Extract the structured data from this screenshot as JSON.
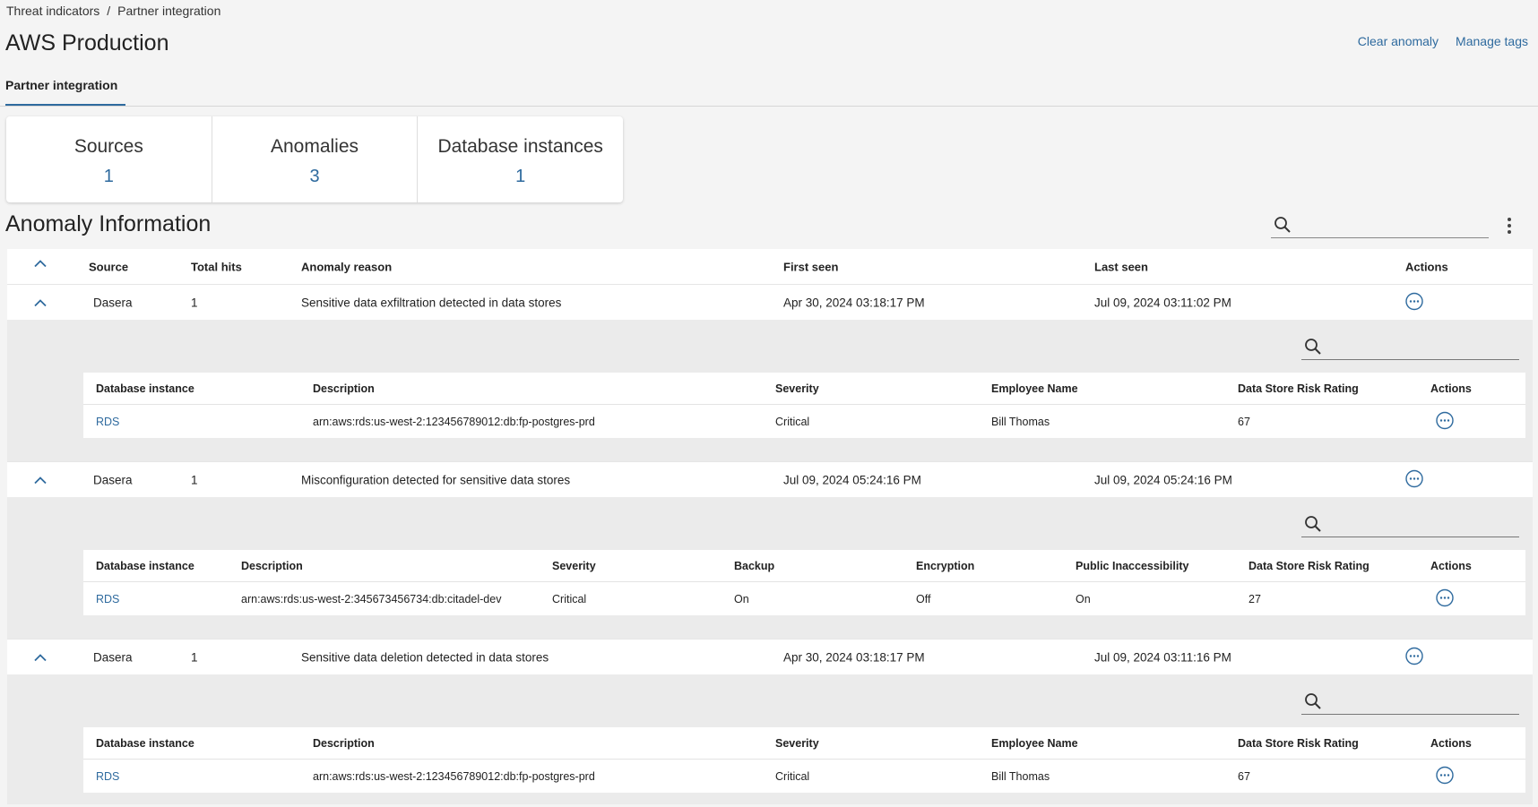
{
  "breadcrumb": {
    "items": [
      "Threat indicators",
      "Partner integration"
    ],
    "separator": "/"
  },
  "page": {
    "title": "AWS Production"
  },
  "header_actions": {
    "clear": "Clear anomaly",
    "tags": "Manage tags"
  },
  "tabs": [
    {
      "label": "Partner integration"
    }
  ],
  "summary": [
    {
      "label": "Sources",
      "value": "1"
    },
    {
      "label": "Anomalies",
      "value": "3"
    },
    {
      "label": "Database instances",
      "value": "1"
    }
  ],
  "section": {
    "title": "Anomaly Information"
  },
  "table": {
    "headers": {
      "source": "Source",
      "hits": "Total hits",
      "reason": "Anomaly reason",
      "first": "First seen",
      "last": "Last seen",
      "actions": "Actions"
    },
    "rows": [
      {
        "source": "Dasera",
        "hits": "1",
        "reason": "Sensitive data exfiltration detected in data stores",
        "first": "Apr 30, 2024 03:18:17 PM",
        "last": "Jul 09, 2024 03:11:02 PM",
        "detail": {
          "headers": {
            "instance": "Database instance",
            "description": "Description",
            "severity": "Severity",
            "employee": "Employee Name",
            "rating": "Data Store Risk Rating",
            "actions": "Actions"
          },
          "row": {
            "instance": "RDS",
            "description": "arn:aws:rds:us-west-2:123456789012:db:fp-postgres-prd",
            "severity": "Critical",
            "employee": "Bill Thomas",
            "rating": "67"
          }
        }
      },
      {
        "source": "Dasera",
        "hits": "1",
        "reason": "Misconfiguration detected for sensitive data stores",
        "first": "Jul 09, 2024 05:24:16 PM",
        "last": "Jul 09, 2024 05:24:16 PM",
        "detail": {
          "headers": {
            "instance": "Database instance",
            "description": "Description",
            "severity": "Severity",
            "backup": "Backup",
            "encryption": "Encryption",
            "public": "Public Inaccessibility",
            "rating": "Data Store Risk Rating",
            "actions": "Actions"
          },
          "row": {
            "instance": "RDS",
            "description": "arn:aws:rds:us-west-2:345673456734:db:citadel-dev",
            "severity": "Critical",
            "backup": "On",
            "encryption": "Off",
            "public": "On",
            "rating": "27"
          }
        }
      },
      {
        "source": "Dasera",
        "hits": "1",
        "reason": "Sensitive data deletion detected in data stores",
        "first": "Apr 30, 2024 03:18:17 PM",
        "last": "Jul 09, 2024 03:11:16 PM",
        "detail": {
          "headers": {
            "instance": "Database instance",
            "description": "Description",
            "severity": "Severity",
            "employee": "Employee Name",
            "rating": "Data Store Risk Rating",
            "actions": "Actions"
          },
          "row": {
            "instance": "RDS",
            "description": "arn:aws:rds:us-west-2:123456789012:db:fp-postgres-prd",
            "severity": "Critical",
            "employee": "Bill Thomas",
            "rating": "67"
          }
        }
      }
    ]
  },
  "icons": {
    "search": "search-icon",
    "kebab": "kebab-menu-icon",
    "chevron": "chevron-up-icon",
    "more": "more-actions-icon"
  },
  "colors": {
    "accent": "#2e6a9e",
    "background": "#f4f4f4",
    "expanded": "#ebebeb"
  }
}
